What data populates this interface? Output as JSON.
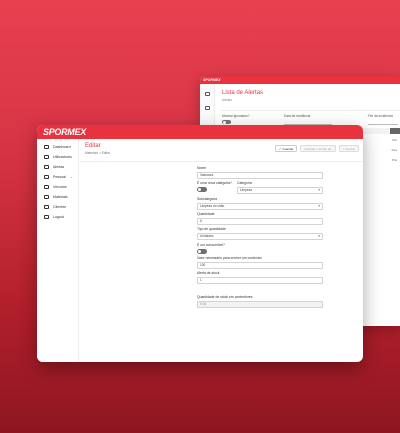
{
  "back_window": {
    "logo": "SPORMEX",
    "title": "Lista de Alertas",
    "breadcrumb": "Alertas",
    "filters": {
      "ignored_label": "Mostrar ignorados?",
      "date_label": "Data da incidência",
      "date_end_label": "Fim da incidência"
    },
    "rows_right": [
      "Rot",
      "Res",
      "Pris"
    ]
  },
  "front_window": {
    "logo": "SPORMEX",
    "sidebar": {
      "items": [
        {
          "label": "Dashboard",
          "icon": "dashboard-icon"
        },
        {
          "label": "Utilizadores",
          "icon": "users-icon"
        },
        {
          "label": "Alertas",
          "icon": "alerts-icon"
        },
        {
          "label": "Pessoal",
          "icon": "person-icon",
          "caret": "⌄"
        },
        {
          "label": "Veículos",
          "icon": "truck-icon"
        },
        {
          "label": "Materiais",
          "icon": "materials-icon"
        },
        {
          "label": "Clientes",
          "icon": "clients-icon"
        },
        {
          "label": "Logout",
          "icon": "logout-icon"
        }
      ]
    },
    "page": {
      "title": "Editar",
      "breadcrumb": "Materiais > Editar"
    },
    "actions": {
      "save_label": "Guardar",
      "apply_label": "Guardar e fechar alt.",
      "close_label": "Fechar"
    },
    "form": {
      "name_label": "Nome",
      "name_value": "Vassoura",
      "new_category_label": "É uma nova categoria?",
      "category_label": "Categoria",
      "category_value": "Limpeza",
      "subcategory_label": "Subcategoria",
      "subcategory_value": "Limpeza do chão",
      "quantity_label": "Quantidade",
      "quantity_value": "6",
      "quantity_type_label": "Tipo de quantidade",
      "quantity_type_value": "Unidades",
      "consumable_label": "É um consumível?",
      "refill_label": "Valor necessário para encher um contentor",
      "refill_value": "100",
      "stock_alert_label": "Alerta de stock",
      "stock_alert_value": "1",
      "container_qty_label": "Quantidade de stock em contentores",
      "container_qty_value": "0.06"
    }
  },
  "colors": {
    "brand": "#e8333f",
    "background_top": "#e8404f",
    "background_bottom": "#8e1620"
  }
}
